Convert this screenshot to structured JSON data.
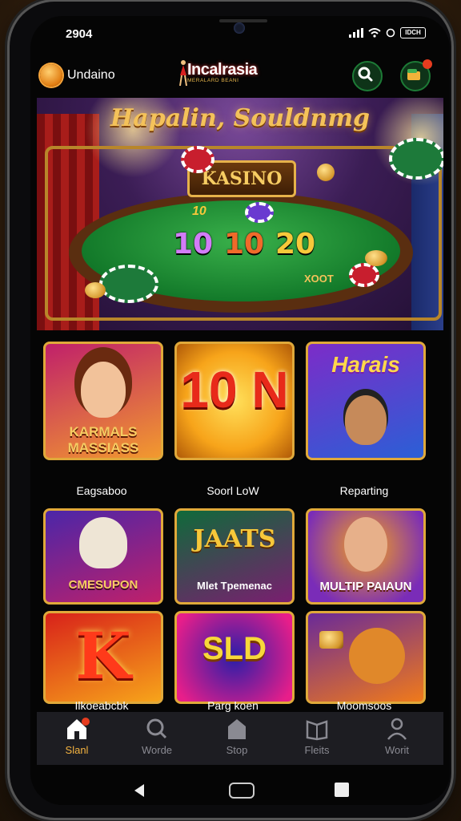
{
  "status_bar": {
    "time": "2904",
    "battery": "IDCH"
  },
  "header": {
    "left_brand": "Undaino",
    "center_brand": "Incalrasia",
    "center_sub": "MERALARD BEANI"
  },
  "hero": {
    "title": "Hapalin, Souldnmg",
    "plate": "KASINO",
    "small_number": "10",
    "numbers": [
      "10",
      "10",
      "20"
    ],
    "table_label": "XOOT"
  },
  "games": [
    {
      "label": "Eagsaboo",
      "art_text": "KARMALS MASSIASS",
      "colors": [
        "#c0206a",
        "#f29a2e"
      ]
    },
    {
      "label": "Soorl LoW",
      "art_text": "10 N",
      "colors": [
        "#f7a41a",
        "#ffe05a"
      ]
    },
    {
      "label": "Reparting",
      "art_text": "Harais",
      "colors": [
        "#7c2cc8",
        "#2b5fd6"
      ]
    },
    {
      "label": "",
      "art_text": "CMESUPON",
      "colors": [
        "#4b26a8",
        "#c0206a"
      ]
    },
    {
      "label": "",
      "art_text": "Mlet Tpemenac",
      "colors": [
        "#0f6a3a",
        "#7a1e70"
      ]
    },
    {
      "label": "",
      "art_text": "MULTIP PAIAUN",
      "colors": [
        "#f07a1a",
        "#7a2cb8"
      ]
    },
    {
      "label": "Ilkoeabcbk",
      "art_text": "K",
      "colors": [
        "#d8221a",
        "#f7a41a"
      ]
    },
    {
      "label": "Parg koen",
      "art_text": "SLD",
      "colors": [
        "#2a1ea8",
        "#e81e8a"
      ]
    },
    {
      "label": "Moomsoos",
      "art_text": "",
      "colors": [
        "#6a2a98",
        "#f07a1a"
      ]
    }
  ],
  "game_captions_2": [
    "CMESUPON",
    "Mlet Tpemenac",
    "MULTIP PAIAUN"
  ],
  "nav": [
    {
      "label": "Slanl",
      "icon": "home-icon",
      "active": true
    },
    {
      "label": "Worde",
      "icon": "search-icon",
      "active": false
    },
    {
      "label": "Stop",
      "icon": "store-icon",
      "active": false
    },
    {
      "label": "Fleits",
      "icon": "book-icon",
      "active": false
    },
    {
      "label": "Worit",
      "icon": "profile-icon",
      "active": false
    }
  ],
  "colors": {
    "accent": "#f4b340",
    "tile_border": "#e0a93a",
    "background": "#050505"
  }
}
